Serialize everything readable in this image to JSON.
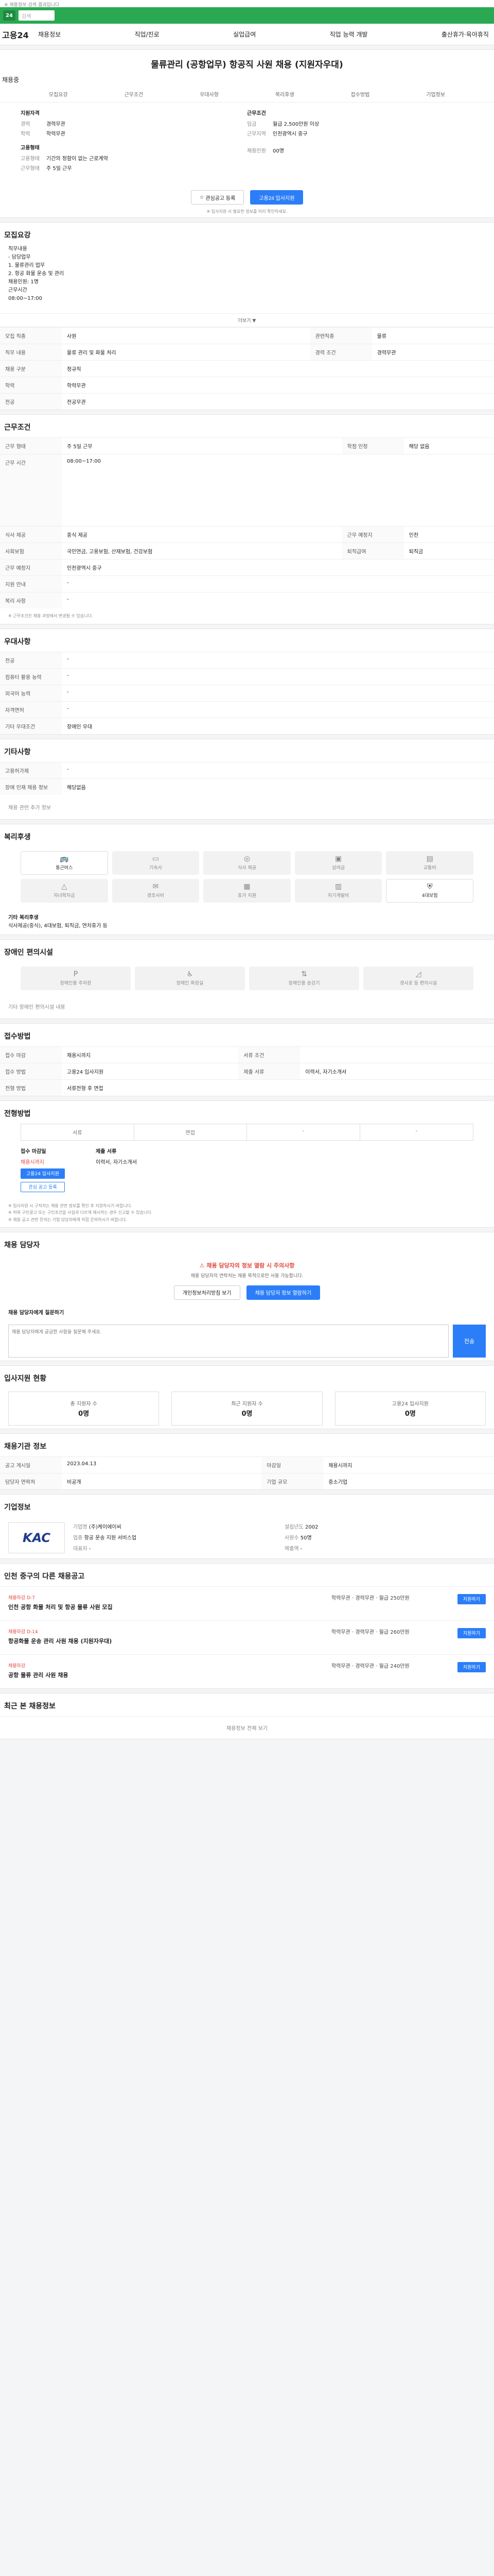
{
  "topbar": {
    "text": "※ 채용정보 검색 결과입니다"
  },
  "header": {
    "logo": "고용24",
    "search_placeholder": "검색",
    "menu": [
      "채용정보",
      "직업/진로",
      "실업급여",
      "직업 능력 개발",
      "출산휴가·육아휴직"
    ]
  },
  "job": {
    "title": "물류관리 (공항업무) 항공직 사원 채용 (지원자우대)",
    "tag": "채용중",
    "tabs": [
      "모집요강",
      "근무조건",
      "우대사항",
      "복리후생",
      "접수방법",
      "기업정보"
    ],
    "left_head": "지원자격",
    "left": [
      {
        "k": "경력",
        "v": "경력무관"
      },
      {
        "k": "학력",
        "v": "학력무관"
      }
    ],
    "left_head2": "고용형태",
    "left2": [
      {
        "k": "고용형태",
        "v": "기간의 정함이 없는 근로계약"
      },
      {
        "k": "근무형태",
        "v": "주 5일 근무"
      }
    ],
    "right_head": "근무조건",
    "right": [
      {
        "k": "임금",
        "v": "월급 2,500만원 이상"
      },
      {
        "k": "근무지역",
        "v": "인천광역시 중구"
      }
    ],
    "right2": [
      {
        "k": "채용인원",
        "v": "00명"
      }
    ],
    "btn_save": "관심공고 등록",
    "btn_apply": "고용24 입사지원",
    "note": "※ 입사지원 시 필요한 정보를 미리 확인하세요."
  },
  "sections": {
    "recruit": "모집요강",
    "recruit_lines": [
      "직무내용",
      "- 담당업무",
      "  1. 물류관리 업무",
      "  2. 항공 화물 운송 및 관리",
      "채용인원: 1명",
      "근무시간",
      "  08:00~17:00"
    ],
    "more": "더보기 ▼",
    "recruit_table": [
      [
        "모집 직종",
        "사원",
        "관련직종",
        "물류"
      ],
      [
        "직무 내용",
        "물류 관리 및 화물 처리",
        "경력 조건",
        "경력무관"
      ],
      [
        "채용 구분",
        "정규직",
        "",
        ""
      ],
      [
        "학력",
        "학력무관",
        "학력",
        ""
      ],
      [
        "전공",
        "전공무관",
        "",
        ""
      ]
    ],
    "conditions": "근무조건",
    "cond_table": [
      [
        "근무 형태",
        "주 5일 근무",
        "학점 인정",
        "해당 없음"
      ],
      [
        "근무 시간",
        "08:00~17:00",
        "",
        ""
      ],
      [
        "식사 제공",
        "중식 제공",
        "근무 예정지",
        "인천"
      ],
      [
        "사회보험",
        "국민연금, 고용보험, 산재보험, 건강보험",
        "퇴직급여",
        "퇴직금"
      ],
      [
        "근무 예정지",
        "인천광역시 중구",
        "",
        ""
      ],
      [
        "지원 안내",
        "-",
        "",
        ""
      ],
      [
        "복리 사항",
        "-",
        "",
        ""
      ]
    ],
    "cond_note": "※ 근무조건은 채용 과정에서 변경될 수 있습니다.",
    "prefer": "우대사항",
    "prefer_table": [
      [
        "전공",
        "-"
      ],
      [
        "컴퓨터 활용 능력",
        "-"
      ],
      [
        "외국어 능력",
        "-"
      ],
      [
        "자격면허",
        "-"
      ],
      [
        "기타 우대조건",
        "장애인 우대"
      ]
    ],
    "other": "기타사항",
    "other_table": [
      [
        "고용허가제",
        "-"
      ],
      [
        "장애 인재 채용 정보",
        "해당없음"
      ]
    ],
    "other_more": "채용 관련 추가 정보",
    "welfare": "복리후생",
    "welfare_items": [
      "통근버스",
      "기숙사",
      "식사 제공",
      "상여금",
      "교통비",
      "자녀학자금",
      "경조사비",
      "휴가 지원",
      "자기계발비",
      "4대보험"
    ],
    "welfare_active": [
      0,
      9
    ],
    "welfare_etc_h": "기타 복리후생",
    "welfare_etc": "식사제공(중식), 4대보험, 퇴직금, 연차휴가 등",
    "disabled": "장애인 편의시설",
    "disabled_items": [
      "장애인용 주차장",
      "장애인 화장실",
      "장애인용 승강기",
      "경사로 등 편의시설"
    ],
    "disabled_etc": "기타 장애인 편의시설 내용",
    "apply": "접수방법",
    "apply_table": [
      [
        "접수 마감",
        "채용시까지",
        "서류 조건",
        ""
      ],
      [
        "접수 방법",
        "고용24 입사지원",
        "제출 서류",
        "이력서, 자기소개서"
      ],
      [
        "전형 방법",
        "서류전형 후 면접",
        "",
        ""
      ]
    ],
    "selection": "전형방법",
    "selection_items": [
      "서류",
      "면접",
      "-",
      "-"
    ],
    "apply2_h1": "접수 마감일",
    "apply2_v1": "채용시까지",
    "apply2_btn1": "고용24 입사지원",
    "apply2_btn2": "관심 공고 등록",
    "apply2_h2": "제출 서류",
    "apply2_v2": "이력서, 자기소개서",
    "bullets": [
      "※ 입사지원 시 구직자는 채용 관련 정보를 확인 후 지원하시기 바랍니다.",
      "※ 허위 구인광고 또는 구인조건을 사실과 다르게 제시하는 경우 신고할 수 있습니다.",
      "※ 채용 공고 관련 문의는 기업 담당자에게 직접 문의하시기 바랍니다."
    ],
    "contact": "채용 담당자",
    "warn1": "채용 담당자의 정보 열람 시 주의사항",
    "warn2": "채용 담당자의 연락처는 채용 목적으로만 사용 가능합니다.",
    "warn_btn1": "개인정보처리방침 보기",
    "warn_btn2": "채용 담당자 정보 열람하기",
    "inquiry_h": "채용 담당자에게 질문하기",
    "inquiry_ph": "채용 담당자에게 궁금한 사항을 질문해 주세요.",
    "inquiry_send": "전송",
    "status": "입사지원 현황",
    "status_items": [
      {
        "label": "총 지원자 수",
        "value": "0명"
      },
      {
        "label": "최근 지원자 수",
        "value": "0명"
      },
      {
        "label": "고용24 입사지원",
        "value": "0명"
      }
    ],
    "info": "채용기관 정보",
    "info_table": [
      [
        "공고 게시일",
        "2023.04.13",
        "마감일",
        "채용시까지"
      ],
      [
        "담당자 연락처",
        "비공개",
        "기업 규모",
        "중소기업"
      ]
    ],
    "company": "기업정보",
    "company_logo": "KAC",
    "company_info": [
      [
        "기업명",
        "(주)케이에이씨"
      ],
      [
        "설립년도",
        "2002"
      ],
      [
        "업종",
        "항공 운송 지원 서비스업"
      ],
      [
        "사원수",
        "50명"
      ],
      [
        "대표자",
        "-"
      ],
      [
        "매출액",
        "-"
      ]
    ],
    "other_jobs": "인천 중구의 다른 채용공고",
    "jobs": [
      {
        "tt": "채용마감 D-7",
        "name": "인천 공항 화물 처리 및 항공 물류 사원 모집",
        "mid": "학력무관 · 경력무관 · 월급 250만원",
        "btn": "지원하기"
      },
      {
        "tt": "채용마감 D-14",
        "name": "항공화물 운송 관리 사원 채용 (지원자우대)",
        "mid": "학력무관 · 경력무관 · 월급 260만원",
        "btn": "지원하기"
      },
      {
        "tt": "채용마감",
        "name": "공항 물류 관리 사원 채용",
        "mid": "학력무관 · 경력무관 · 월급 240만원",
        "btn": "지원하기"
      }
    ],
    "recent": "최근 본 채용정보",
    "recent_more": "채용정보 전체 보기"
  }
}
